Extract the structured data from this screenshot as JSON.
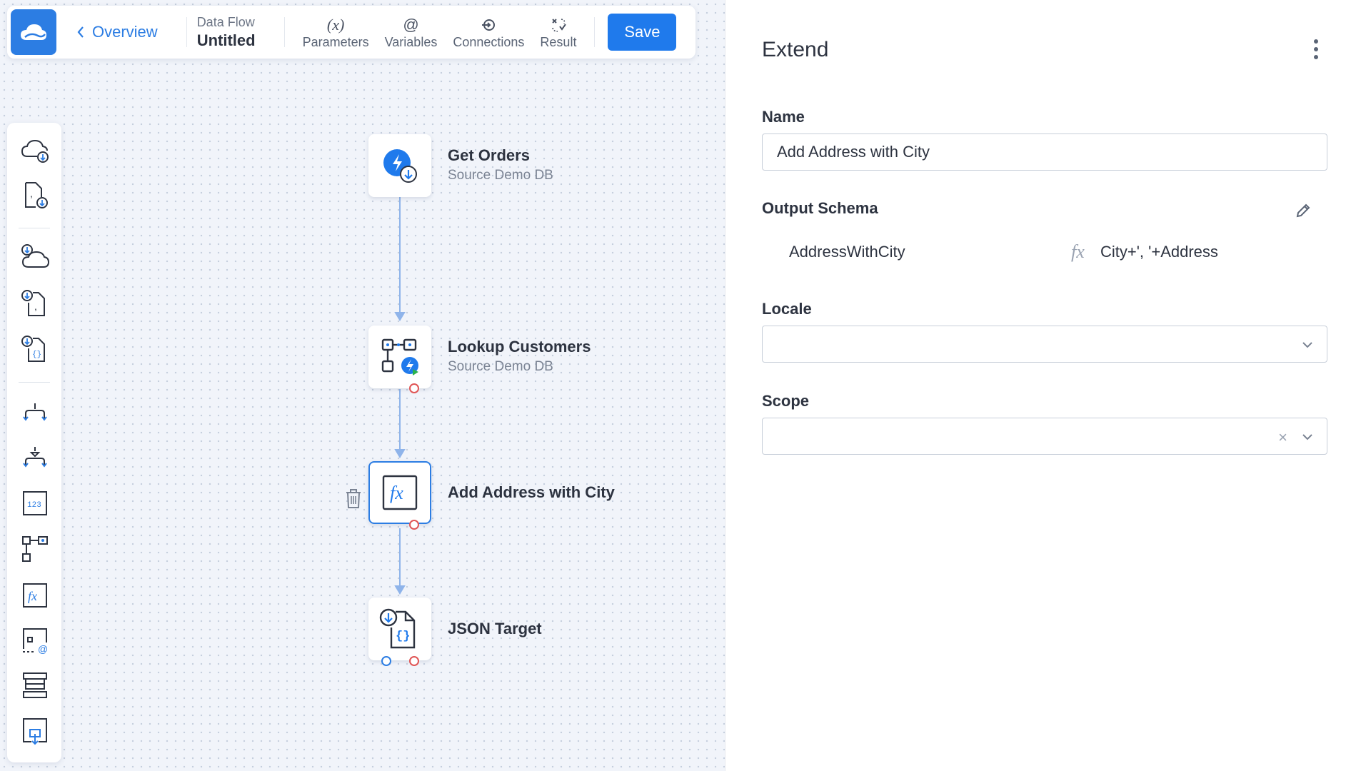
{
  "header": {
    "back_label": "Overview",
    "flow_kind": "Data Flow",
    "flow_name": "Untitled",
    "tools": [
      {
        "icon": "(x)",
        "label": "Parameters"
      },
      {
        "icon": "@",
        "label": "Variables"
      },
      {
        "icon": "connections-icon",
        "label": "Connections"
      },
      {
        "icon": "result-icon",
        "label": "Result"
      }
    ],
    "save_label": "Save"
  },
  "palette": {
    "items": [
      "cloud-source-icon",
      "file-source-icon",
      "cloud-target-icon",
      "file-target-icon",
      "json-target-icon",
      "split-icon",
      "merge-icon",
      "row-count-icon",
      "lookup-icon",
      "extend-icon",
      "value-icon",
      "table-icon",
      "buffer-icon"
    ]
  },
  "flow": {
    "nodes": [
      {
        "title": "Get Orders",
        "subtitle": "Source Demo DB"
      },
      {
        "title": "Lookup Customers",
        "subtitle": "Source Demo DB"
      },
      {
        "title": "Add Address with City",
        "subtitle": ""
      },
      {
        "title": "JSON Target",
        "subtitle": ""
      }
    ]
  },
  "panel": {
    "title": "Extend",
    "name_label": "Name",
    "name_value": "Add Address with City",
    "schema_label": "Output Schema",
    "schema_rows": [
      {
        "column": "AddressWithCity",
        "fx": "fx",
        "expression": "City+', '+Address"
      }
    ],
    "locale_label": "Locale",
    "locale_value": "",
    "scope_label": "Scope",
    "scope_value": ""
  },
  "colors": {
    "accent": "#1f7aec",
    "canvas": "#f1f4fa",
    "edge": "#8fb4ea",
    "port_out": "#e05555"
  }
}
